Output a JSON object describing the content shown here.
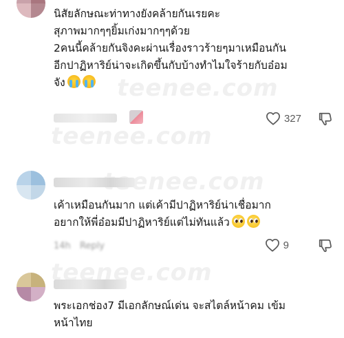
{
  "watermark": "teenee.com",
  "comments": [
    {
      "lines": [
        "นิสัยลักษณะท่าทางยังคล้ายกันเรยคะ",
        "สุภาพมากๆๆยิ้มเก่งมากๆๆด้วย",
        "2คนนี้คล้ายกันจิงคะผ่านเรื่องราวร้ายๆมาเหมือนกัน",
        "อีกปาฏิหาริย์น่าจะเกิดขึ้นกับบ้างทำไมใจร้ายกับอ๋อม",
        "จัง"
      ],
      "emojis": [
        "crying-face",
        "crying-face"
      ],
      "likes": "327"
    },
    {
      "lines": [
        "เค้าเหมือนกันมาก แต่เค้ามีปาฏิหาริย์น่าเชื่อมาก",
        "อยากให้พี่อ๋อมมีปาฏิหาริย์แต่ไม่ทันแล้ว"
      ],
      "emojis": [
        "pleading-face",
        "pleading-face"
      ],
      "time": "14h",
      "reply": "Reply",
      "likes": "9"
    },
    {
      "lines": [
        "พระเอกช่อง7 มีเอกลักษณ์เด่น จะสไตล์หน้าคม เข้ม",
        "หน้าไทย"
      ]
    }
  ],
  "colors": {
    "text": "#161616",
    "icon": "#5a5a5a",
    "meta": "#9a9a9a"
  }
}
